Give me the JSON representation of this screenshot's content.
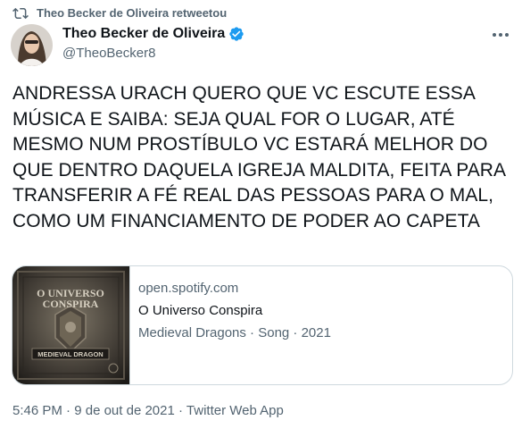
{
  "retweet": {
    "icon": "retweet-icon",
    "text": "Theo Becker de Oliveira retweetou"
  },
  "author": {
    "display_name": "Theo Becker de Oliveira",
    "handle": "@TheoBecker8",
    "verified": true,
    "verified_color": "#1d9bf0"
  },
  "tweet": {
    "text": "ANDRESSA URACH QUERO QUE VC ESCUTE ESSA MÚSICA E SAIBA: SEJA QUAL FOR O LUGAR, ATÉ MESMO NUM PROSTÍBULO VC ESTARÁ MELHOR DO QUE DENTRO DAQUELA IGREJA MALDITA, FEITA PARA TRANSFERIR A FÉ REAL DAS PESSOAS PARA O MAL, COMO UM FINANCIAMENTO DE PODER AO CAPETA"
  },
  "card": {
    "domain": "open.spotify.com",
    "title": "O Universo Conspira",
    "description": "Medieval Dragons · Song · 2021",
    "thumb_title_line1": "O UNIVERSO",
    "thumb_title_line2": "CONSPIRA",
    "thumb_band": "MEDIEVAL DRAGON"
  },
  "meta": {
    "time": "5:46 PM",
    "separator": "·",
    "date": "9 de out de 2021",
    "source": "Twitter Web App"
  },
  "colors": {
    "text_primary": "#0f1419",
    "text_secondary": "#536471",
    "border": "#cfd9de",
    "verified": "#1d9bf0"
  }
}
